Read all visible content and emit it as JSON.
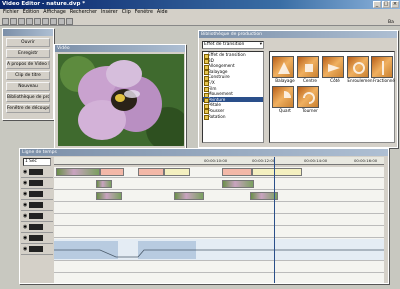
{
  "app": {
    "title": "Video Editor - nature.dvp *"
  },
  "menubar": [
    "Fichier",
    "Édition",
    "Affichage",
    "Rechercher",
    "Insérer",
    "Clip",
    "Fenêtre",
    "Aide"
  ],
  "left_menu": {
    "items": [
      "Ouvrir",
      "Enregistr",
      "A propos de Video Ed",
      "Clip de titre",
      "Nouveau",
      "Bibliothèque de productio",
      "Fenêtre de découpe"
    ]
  },
  "preview": {
    "title": "Vidéo",
    "timecode_left": "00:00:00:00",
    "timecode_right": "00:00:00:00"
  },
  "library": {
    "title": "Bibliothèque de production",
    "combo_value": "Effet de transition",
    "tree": [
      "Effet de transition",
      "3D",
      "Allongement",
      "Balayage",
      "Construire",
      "F/X",
      "Film",
      "Mouvement",
      "Peinture",
      "Pétale",
      "Pousser",
      "Rotation"
    ],
    "thumbs_row1": [
      "Balayage",
      "Centre",
      "Côté",
      "Enroulemen",
      "Fractionné"
    ],
    "thumbs_row2": [
      "Quart",
      "Tourner"
    ]
  },
  "timeline": {
    "title": "Ligne de temps",
    "scale_label": "1 Sec",
    "ruler": [
      "00:00:10:00",
      "00:00:12:00",
      "00:00:14:00",
      "00:00:16:00"
    ]
  },
  "colors": {
    "titlebar": "#0a246a",
    "accent": "#2a4f8a"
  },
  "status": {
    "right_edge": "Ba"
  }
}
